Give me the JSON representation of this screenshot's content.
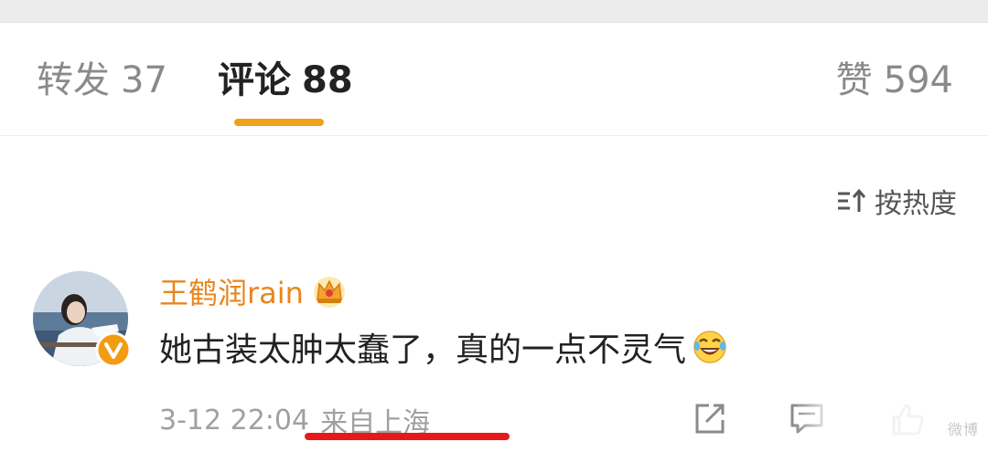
{
  "tabs": {
    "reposts": {
      "label": "转发",
      "count": "37"
    },
    "comments": {
      "label": "评论",
      "count": "88"
    },
    "likes": {
      "label": "赞",
      "count": "594"
    }
  },
  "active_tab": "comments",
  "colors": {
    "accent_underline": "#f0a11b",
    "username": "#e8861e",
    "highlight_underline": "#e81818"
  },
  "sort": {
    "label": "按热度",
    "icon": "sort-icon"
  },
  "comment": {
    "username": "王鹤润rain",
    "badge_icon": "crown-icon",
    "text": "她古装太肿太蠢了，真的一点不灵气",
    "emoji": "laugh-cry-emoji",
    "timestamp": "3-12 22:04",
    "location": "来自上海",
    "verified": true
  },
  "actions": [
    "share-icon",
    "comment-icon",
    "like-icon"
  ],
  "watermark": "微博"
}
